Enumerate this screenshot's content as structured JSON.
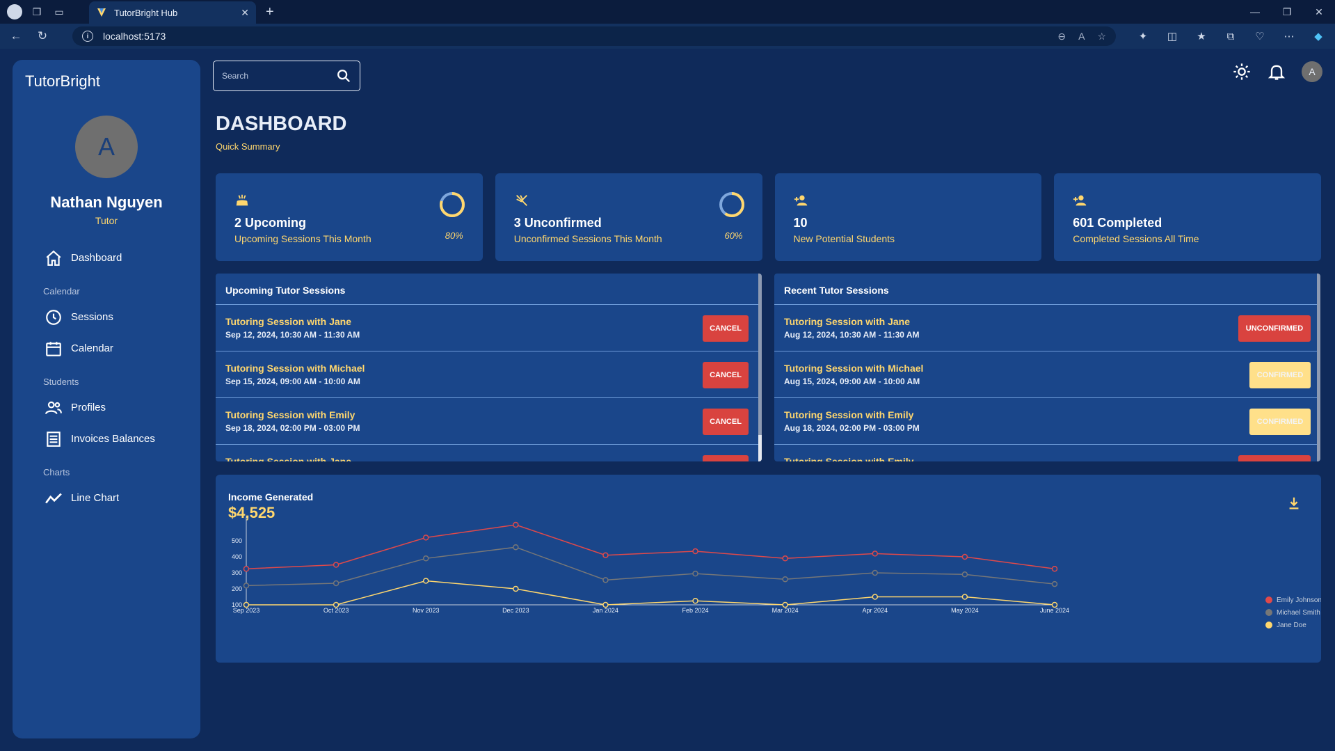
{
  "browser": {
    "tab_title": "TutorBright Hub",
    "url": "localhost:5173"
  },
  "brand": "TutorBright",
  "user": {
    "initial": "A",
    "name": "Nathan Nguyen",
    "role": "Tutor"
  },
  "nav": {
    "dashboard": "Dashboard",
    "section_calendar": "Calendar",
    "sessions": "Sessions",
    "calendar": "Calendar",
    "section_students": "Students",
    "profiles": "Profiles",
    "invoices": "Invoices Balances",
    "section_charts": "Charts",
    "line_chart": "Line Chart"
  },
  "search": {
    "placeholder": "Search"
  },
  "topbar": {
    "avatar_initial": "A"
  },
  "page": {
    "title": "DASHBOARD",
    "subtitle": "Quick Summary"
  },
  "cards": [
    {
      "value": "2 Upcoming",
      "label": "Upcoming Sessions This Month",
      "percent": "80%",
      "progress": 0.8,
      "icon": "celebration-icon"
    },
    {
      "value": "3 Unconfirmed",
      "label": "Unconfirmed Sessions This Month",
      "percent": "60%",
      "progress": 0.6,
      "icon": "crossed-tools-icon"
    },
    {
      "value": "10",
      "label": "New Potential Students",
      "icon": "person-add-icon"
    },
    {
      "value": "601 Completed",
      "label": "Completed Sessions All Time",
      "icon": "person-add-icon"
    }
  ],
  "upcoming": {
    "title": "Upcoming Tutor Sessions",
    "rows": [
      {
        "title": "Tutoring Session with Jane",
        "time": "Sep 12, 2024, 10:30 AM - 11:30 AM",
        "action": "CANCEL"
      },
      {
        "title": "Tutoring Session with Michael",
        "time": "Sep 15, 2024, 09:00 AM - 10:00 AM",
        "action": "CANCEL"
      },
      {
        "title": "Tutoring Session with Emily",
        "time": "Sep 18, 2024, 02:00 PM - 03:00 PM",
        "action": "CANCEL"
      },
      {
        "title": "Tutoring Session with Jane",
        "time": "",
        "action": ""
      }
    ]
  },
  "recent": {
    "title": "Recent Tutor Sessions",
    "rows": [
      {
        "title": "Tutoring Session with Jane",
        "time": "Aug 12, 2024, 10:30 AM - 11:30 AM",
        "status": "UNCONFIRMED"
      },
      {
        "title": "Tutoring Session with Michael",
        "time": "Aug 15, 2024, 09:00 AM - 10:00 AM",
        "status": "CONFIRMED"
      },
      {
        "title": "Tutoring Session with Emily",
        "time": "Aug 18, 2024, 02:00 PM - 03:00 PM",
        "status": "CONFIRMED"
      },
      {
        "title": "Tutoring Session with Emily",
        "time": "",
        "status": ""
      }
    ]
  },
  "colors": {
    "accent": "#ffd76e",
    "red": "#d9433f",
    "confirmed": "#ffe08a",
    "series_emily": "#e0494a",
    "series_michael": "#777777",
    "series_jane": "#ffd76e"
  },
  "chart": {
    "title": "Income Generated",
    "total": "$4,525"
  },
  "chart_data": {
    "type": "line",
    "categories": [
      "Sep 2023",
      "Oct 2023",
      "Nov 2023",
      "Dec 2023",
      "Jan 2024",
      "Feb 2024",
      "Mar 2024",
      "Apr 2024",
      "May 2024",
      "June 2024"
    ],
    "series": [
      {
        "name": "Emily Johnson",
        "values": [
          325,
          350,
          520,
          600,
          410,
          435,
          390,
          420,
          400,
          325
        ]
      },
      {
        "name": "Michael Smith",
        "values": [
          220,
          235,
          390,
          460,
          255,
          295,
          260,
          300,
          290,
          230
        ]
      },
      {
        "name": "Jane Doe",
        "values": [
          100,
          100,
          250,
          200,
          100,
          125,
          100,
          150,
          150,
          100
        ]
      }
    ],
    "yticks": [
      100,
      200,
      300,
      400,
      500
    ],
    "ylim": [
      100,
      600
    ],
    "legend": "right"
  }
}
